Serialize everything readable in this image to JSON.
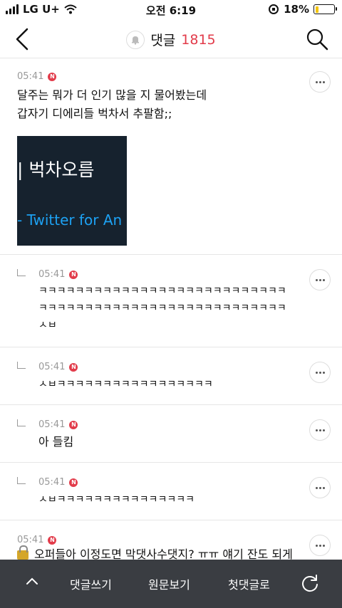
{
  "status_bar": {
    "carrier": "LG U+",
    "time": "오전 6:19",
    "battery": "18%",
    "battery_level": 0.18
  },
  "header": {
    "title": "댓글",
    "count": "1815"
  },
  "comments": [
    {
      "time": "05:41",
      "badge": "N",
      "text_lines": [
        "달주는 뭐가 더 인기 많을 지 물어봤는데",
        "갑자기 디에리들 벅차서 추팔함;;"
      ],
      "image": {
        "line1": "| 벅차오름",
        "line2": "- Twitter for An"
      }
    },
    {
      "time": "05:41",
      "badge": "N",
      "text_lines": [
        "ㅋㅋㅋㅋㅋㅋㅋㅋㅋㅋㅋㅋㅋㅋㅋㅋㅋㅋㅋㅋㅋㅋㅋㅋㅋㅋㅋ",
        "ㅋㅋㅋㅋㅋㅋㅋㅋㅋㅋㅋㅋㅋㅋㅋㅋㅋㅋㅋㅋㅋㅋㅋㅋㅋㅋㅋ",
        "ㅅㅂ"
      ]
    },
    {
      "time": "05:41",
      "badge": "N",
      "text_lines": [
        "ㅅㅂㅋㅋㅋㅋㅋㅋㅋㅋㅋㅋㅋㅋㅋㅋㅋㅋㅋ"
      ]
    },
    {
      "time": "05:41",
      "badge": "N",
      "text_lines": [
        "아 들킴"
      ]
    },
    {
      "time": "05:41",
      "badge": "N",
      "text_lines": [
        "ㅅㅂㅋㅋㅋㅋㅋㅋㅋㅋㅋㅋㅋㅋㅋㅋㅋ"
      ]
    },
    {
      "time": "05:41",
      "badge": "N",
      "text_lines": [
        "오퍼들아 이정도면 막댓사수댓지? ㅠㅠ 얘기 잔도 되게"
      ]
    }
  ],
  "bottom_bar": {
    "write": "댓글쓰기",
    "view_original": "원문보기",
    "first_comment": "첫댓글로"
  }
}
